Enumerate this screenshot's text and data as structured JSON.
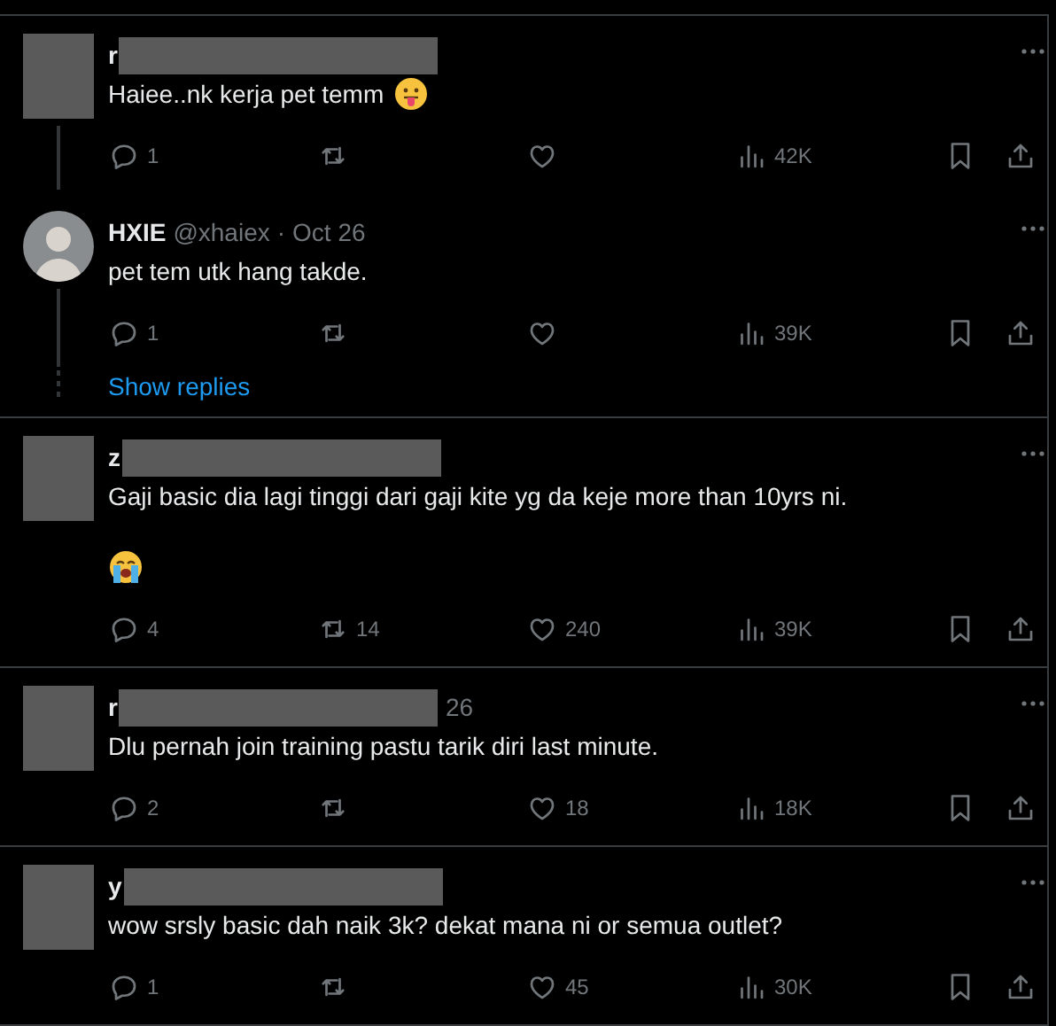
{
  "threads": [
    {
      "posts": [
        {
          "kind": "redacted",
          "name_start": "r",
          "text": "Haiee..nk kerja pet temm",
          "emoji": {
            "kind": "tongue"
          },
          "stats": {
            "replies": "1",
            "views": "42K"
          }
        },
        {
          "kind": "profile",
          "name": "HXIE",
          "handle": "@xhaiex",
          "separator": "·",
          "date": "Oct 26",
          "text": "pet tem utk hang takde.",
          "stats": {
            "replies": "1",
            "views": "39K"
          }
        }
      ],
      "show_replies": "Show replies"
    },
    {
      "posts": [
        {
          "kind": "redacted",
          "name_start": "z",
          "text": "Gaji basic dia lagi tinggi dari gaji kite yg da keje more than 10yrs ni.",
          "emoji_paragraph": {
            "kind": "crying"
          },
          "stats": {
            "replies": "4",
            "reposts": "14",
            "likes": "240",
            "views": "39K"
          }
        }
      ]
    },
    {
      "posts": [
        {
          "kind": "redacted",
          "name_start": "r",
          "name_end": "26",
          "text": "Dlu pernah join training pastu tarik diri last minute.",
          "stats": {
            "replies": "2",
            "likes": "18",
            "views": "18K"
          }
        }
      ]
    },
    {
      "posts": [
        {
          "kind": "redacted",
          "name_start": "y",
          "text": "wow srsly basic dah naik 3k? dekat mana ni or semua outlet?",
          "stats": {
            "replies": "1",
            "likes": "45",
            "views": "30K"
          }
        }
      ]
    }
  ]
}
